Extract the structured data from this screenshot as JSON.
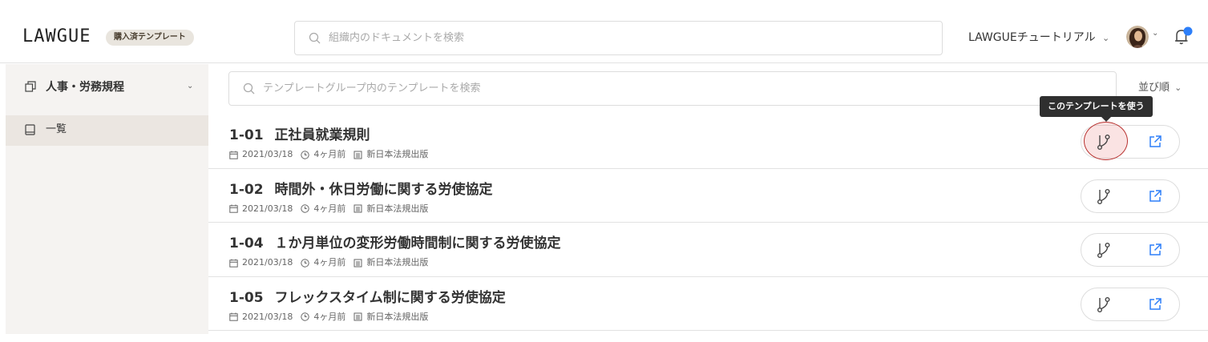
{
  "header": {
    "logo": "LAWGUE",
    "badge": "購入済テンプレート",
    "search_placeholder": "組織内のドキュメントを検索",
    "workspace": "LAWGUEチュートリアル",
    "workspace_caret": "⌄",
    "avatar_caret": "⌄",
    "notification_dot_color": "#2d7ff9"
  },
  "sidebar": {
    "group_label": "人事・労務規程",
    "group_caret": "⌄",
    "items": [
      {
        "label": "一覧"
      }
    ]
  },
  "main": {
    "search_placeholder": "テンプレートグループ内のテンプレートを検索",
    "sort_label": "並び順",
    "sort_caret": "⌄",
    "tooltip": "このテンプレートを使う",
    "templates": [
      {
        "code": "1-01",
        "title": "正社員就業規則",
        "date": "2021/03/18",
        "ago": "4ヶ月前",
        "publisher": "新日本法規出版"
      },
      {
        "code": "1-02",
        "title": "時間外・休日労働に関する労使協定",
        "date": "2021/03/18",
        "ago": "4ヶ月前",
        "publisher": "新日本法規出版"
      },
      {
        "code": "1-04",
        "title": "１か月単位の変形労働時間制に関する労使協定",
        "date": "2021/03/18",
        "ago": "4ヶ月前",
        "publisher": "新日本法規出版"
      },
      {
        "code": "1-05",
        "title": "フレックスタイム制に関する労使協定",
        "date": "2021/03/18",
        "ago": "4ヶ月前",
        "publisher": "新日本法規出版"
      }
    ]
  },
  "colors": {
    "accent_link": "#2d7ff9",
    "highlight": "#b8312f",
    "sidebar_bg": "#f5f3f1",
    "badge_bg": "#e9e5de"
  }
}
